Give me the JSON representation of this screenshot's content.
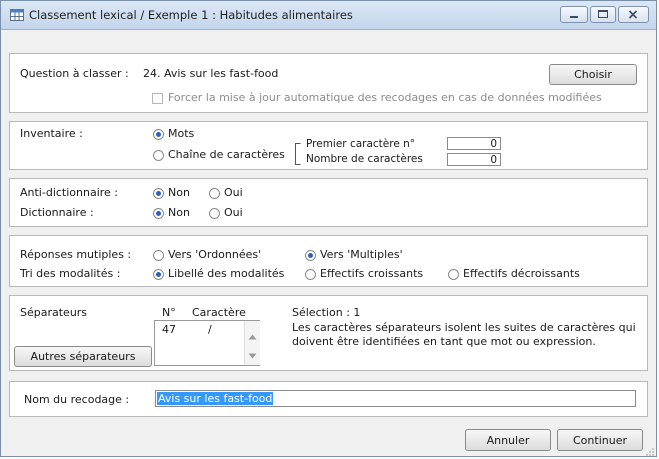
{
  "window": {
    "title": "Classement lexical / Exemple 1 : Habitudes alimentaires",
    "app_icon": "table-icon"
  },
  "question": {
    "label": "Question à classer :",
    "value": "24. Avis sur les fast-food",
    "choose_button": "Choisir",
    "force_update_label": "Forcer la mise à jour automatique des recodages en cas de données modifiées",
    "force_update_checked": false
  },
  "inventory": {
    "label": "Inventaire :",
    "option_words": "Mots",
    "option_chars": "Chaîne de caractères",
    "selected": "Mots",
    "first_char_label": "Premier caractère n°",
    "first_char_value": "0",
    "num_chars_label": "Nombre de caractères",
    "num_chars_value": "0"
  },
  "anti_dictionary": {
    "label": "Anti-dictionnaire :",
    "no": "Non",
    "yes": "Oui",
    "selected": "Non"
  },
  "dictionary": {
    "label": "Dictionnaire :",
    "no": "Non",
    "yes": "Oui",
    "selected": "Non"
  },
  "multiple": {
    "label": "Réponses mutiples :",
    "option_ordered": "Vers 'Ordonnées'",
    "option_multiple": "Vers 'Multiples'",
    "selected": "Vers 'Multiples'"
  },
  "sort": {
    "label": "Tri des modalités :",
    "option_label": "Libellé des modalités",
    "option_asc": "Effectifs croissants",
    "option_desc": "Effectifs décroissants",
    "selected": "Libellé des modalités"
  },
  "separators": {
    "label": "Séparateurs",
    "col_number": "N°",
    "col_char": "Caractère",
    "rows": [
      {
        "number": "47",
        "char": "/"
      }
    ],
    "selection": "Sélection : 1",
    "description": [
      "Les caractères séparateurs isolent les suites de caractères qui",
      "doivent être identifiées en tant que mot ou expression."
    ],
    "other_button": "Autres séparateurs"
  },
  "recode": {
    "label": "Nom du recodage :",
    "value": "Avis sur les fast-food"
  },
  "footer": {
    "cancel": "Annuler",
    "continue": "Continuer"
  },
  "colors": {
    "accent": "#2a63b8",
    "selection": "#3399ff",
    "titlebar": "#c4d6ec"
  }
}
